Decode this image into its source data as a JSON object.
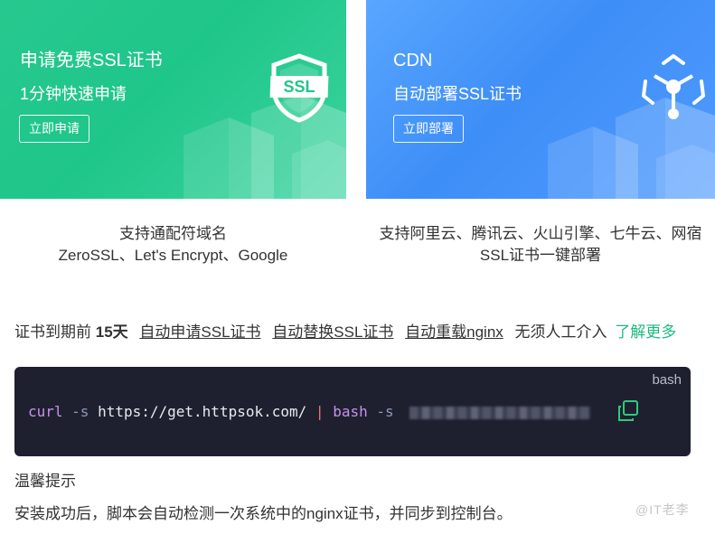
{
  "ssl_card": {
    "title": "申请免费SSL证书",
    "subtitle": "1分钟快速申请",
    "button_label": "立即申请",
    "badge_text": "SSL",
    "bg_color": "#1fc689"
  },
  "cdn_card": {
    "title": "CDN",
    "subtitle": "自动部署SSL证书",
    "button_label": "立即部署",
    "bg_color": "#3e8ef7"
  },
  "ssl_feature": {
    "line1": "支持通配符域名",
    "line2": "ZeroSSL、Let's Encrypt、Google"
  },
  "cdn_feature": {
    "line1": "支持阿里云、腾讯云、火山引擎、七牛云、网宿",
    "line2": "SSL证书一键部署"
  },
  "info": {
    "prefix": "证书到期前",
    "days": "15天",
    "link1": "自动申请SSL证书",
    "link2": "自动替换SSL证书",
    "link3": "自动重载nginx",
    "plain": "无须人工介入",
    "more": "了解更多",
    "more_color": "#1fba7f"
  },
  "code": {
    "lang": "bash",
    "cmd1": "curl",
    "arg1": "-s",
    "url": "https://get.httpsok.com/",
    "pipe": "|",
    "cmd2": "bash",
    "arg2": "-s",
    "copy_icon": "copy-icon",
    "bg_color": "#1e2030"
  },
  "tip": {
    "title": "温馨提示",
    "text": "安装成功后，脚本会自动检测一次系统中的nginx证书，并同步到控制台。"
  },
  "watermark": "@IT老李"
}
